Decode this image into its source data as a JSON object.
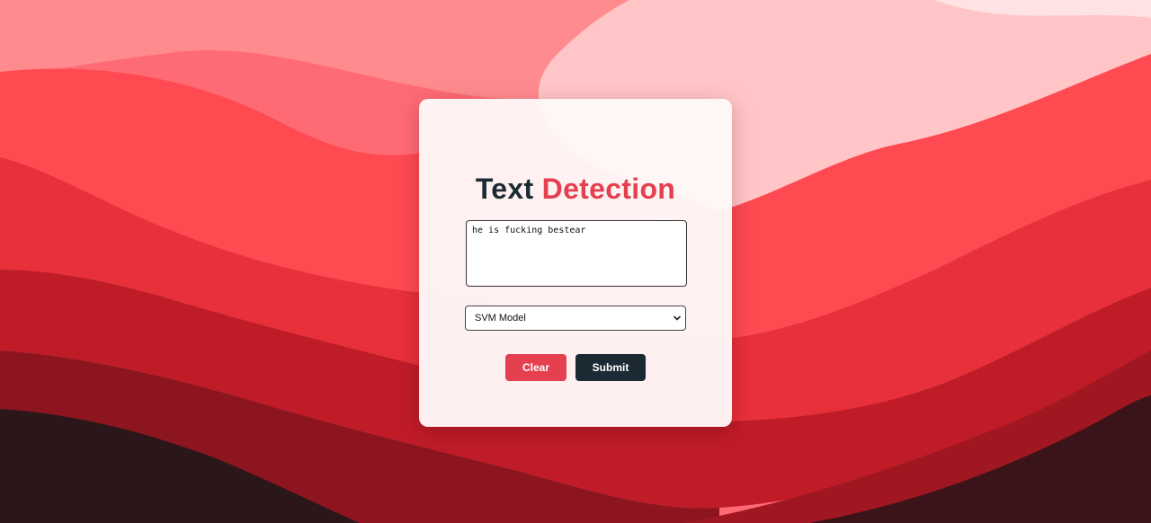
{
  "title": {
    "word1": "Text",
    "word2": "Detection"
  },
  "input": {
    "value": "he is fucking bestear"
  },
  "model_select": {
    "selected": "SVM Model"
  },
  "buttons": {
    "clear_label": "Clear",
    "submit_label": "Submit"
  },
  "colors": {
    "accent_red": "#e4404f",
    "dark_navy": "#1b2a33",
    "card_bg": "#fff8f8"
  },
  "icons": {
    "select_arrow": "chevron-down-icon"
  }
}
